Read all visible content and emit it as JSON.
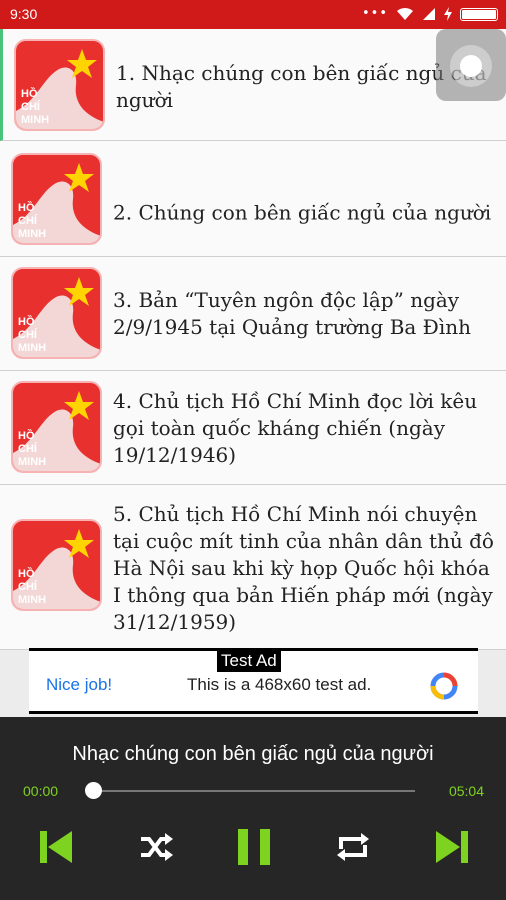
{
  "status_bar": {
    "time": "9:30",
    "dots": "•••"
  },
  "tracks": [
    {
      "title": "1. Nhạc chúng con bên giấc ngủ của người"
    },
    {
      "title": "2. Chúng con bên giấc ngủ của người"
    },
    {
      "title": "3. Bản “Tuyên ngôn độc lập” ngày 2/9/1945 tại Quảng trường Ba Đình"
    },
    {
      "title": "4. Chủ tịch Hồ Chí Minh đọc lời kêu gọi toàn quốc kháng chiến (ngày 19/12/1946)"
    },
    {
      "title": "5. Chủ tịch Hồ Chí Minh nói chuyện tại cuộc mít tinh của nhân dân thủ đô Hà Nội sau khi kỳ họp Quốc hội khóa I thông qua bản Hiến pháp mới (ngày 31/12/1959)"
    }
  ],
  "thumbnail": {
    "line1": "HỒ",
    "line2": "CHÍ",
    "line3": "MINH"
  },
  "ad": {
    "tag": "Test Ad",
    "nice": "Nice job!",
    "text": "This is a 468x60 test ad."
  },
  "player": {
    "title": "Nhạc chúng con bên giấc ngủ của người",
    "current_time": "00:00",
    "total_time": "05:04",
    "progress": 0,
    "accent": "#7ed321"
  },
  "icons": {
    "prev": "skip-previous-icon",
    "shuffle": "shuffle-icon",
    "pause": "pause-icon",
    "repeat": "repeat-icon",
    "next": "skip-next-icon"
  },
  "colors": {
    "status_bar": "#d01919",
    "thumb": "#e8312f",
    "player_bg": "#262626"
  }
}
